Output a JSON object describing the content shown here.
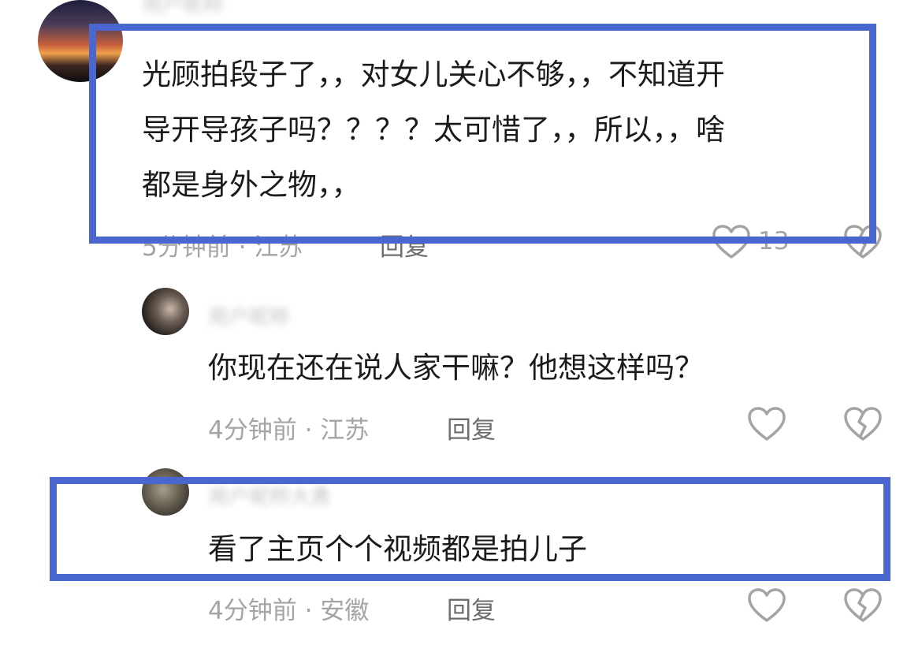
{
  "comments": [
    {
      "username": "用户昵称",
      "text_lines": [
        "光顾拍段子了，，对女儿关心不够，，不知道开",
        "导开导孩子吗？？？？太可惜了，，所以，，啥",
        "都是身外之物，，"
      ],
      "time": "5分钟前",
      "location": "江苏",
      "reply_label": "回复",
      "like_count": "13",
      "like_icon": "heart-outline",
      "dislike_icon": "broken-heart"
    },
    {
      "username": "用户昵称",
      "text": "你现在还在说人家干嘛？他想这样吗？",
      "time": "4分钟前",
      "location": "江苏",
      "reply_label": "回复",
      "like_icon": "heart-outline",
      "dislike_icon": "broken-heart"
    },
    {
      "username": "用户昵称大勇",
      "text": "看了主页个个视频都是拍儿子",
      "time": "4分钟前",
      "location": "安徽",
      "reply_label": "回复",
      "like_icon": "heart-outline",
      "dislike_icon": "broken-heart"
    }
  ],
  "meta_separator": " · ",
  "highlight_color": "#4a67cf"
}
